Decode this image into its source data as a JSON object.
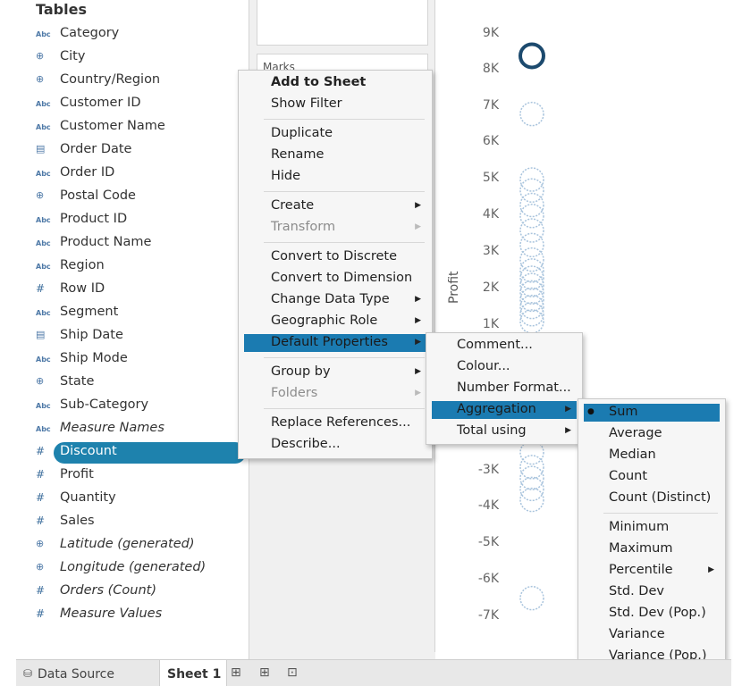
{
  "data_pane": {
    "title": "Tables",
    "fields": [
      {
        "type": "abc",
        "name": "Category",
        "italic": false
      },
      {
        "type": "globe",
        "name": "City",
        "italic": false
      },
      {
        "type": "globe",
        "name": "Country/Region",
        "italic": false
      },
      {
        "type": "abc",
        "name": "Customer ID",
        "italic": false
      },
      {
        "type": "abc",
        "name": "Customer Name",
        "italic": false
      },
      {
        "type": "cal",
        "name": "Order Date",
        "italic": false
      },
      {
        "type": "abc",
        "name": "Order ID",
        "italic": false
      },
      {
        "type": "globe",
        "name": "Postal Code",
        "italic": false
      },
      {
        "type": "abc",
        "name": "Product ID",
        "italic": false
      },
      {
        "type": "abc",
        "name": "Product Name",
        "italic": false
      },
      {
        "type": "abc",
        "name": "Region",
        "italic": false
      },
      {
        "type": "hash",
        "name": "Row ID",
        "italic": false
      },
      {
        "type": "abc",
        "name": "Segment",
        "italic": false
      },
      {
        "type": "cal",
        "name": "Ship Date",
        "italic": false
      },
      {
        "type": "abc",
        "name": "Ship Mode",
        "italic": false
      },
      {
        "type": "globe",
        "name": "State",
        "italic": false
      },
      {
        "type": "abc",
        "name": "Sub-Category",
        "italic": false
      },
      {
        "type": "abc",
        "name": "Measure Names",
        "italic": true
      },
      {
        "type": "hash",
        "name": "Discount",
        "italic": false,
        "selected": true
      },
      {
        "type": "hash",
        "name": "Profit",
        "italic": false
      },
      {
        "type": "hash",
        "name": "Quantity",
        "italic": false
      },
      {
        "type": "hash",
        "name": "Sales",
        "italic": false
      },
      {
        "type": "globe",
        "name": "Latitude (generated)",
        "italic": true
      },
      {
        "type": "globe",
        "name": "Longitude (generated)",
        "italic": true
      },
      {
        "type": "hash",
        "name": "Orders (Count)",
        "italic": true
      },
      {
        "type": "hash",
        "name": "Measure Values",
        "italic": true
      }
    ],
    "icon_glyphs": {
      "abc": "Abc",
      "globe": "⊕",
      "cal": "▤",
      "hash": "#"
    }
  },
  "shelves": {
    "marks_label": "Marks"
  },
  "view": {
    "y_axis_title": "Profit",
    "y_ticks": [
      "9K",
      "8K",
      "7K",
      "6K",
      "5K",
      "4K",
      "3K",
      "2K",
      "1K",
      "-3K",
      "-4K",
      "-5K",
      "-6K",
      "-7K"
    ]
  },
  "chart_data": {
    "type": "scatter",
    "ylabel": "Profit",
    "ylim": [
      -7500,
      9300
    ],
    "x": [
      0
    ],
    "points_profit": [
      8400,
      6800,
      5000,
      4700,
      4300,
      4000,
      3600,
      3200,
      2800,
      2500,
      2300,
      2100,
      1900,
      1700,
      1500,
      1300,
      1100,
      -2500,
      -2900,
      -3200,
      -3500,
      -3800,
      -6500
    ],
    "highlighted_point": 8400
  },
  "context_menu": {
    "items": [
      {
        "label": "Add to Sheet",
        "bold": true
      },
      {
        "label": "Show Filter"
      },
      {
        "sep": true
      },
      {
        "label": "Duplicate"
      },
      {
        "label": "Rename"
      },
      {
        "label": "Hide"
      },
      {
        "sep": true
      },
      {
        "label": "Create",
        "submenu": true
      },
      {
        "label": "Transform",
        "submenu": true,
        "disabled": true
      },
      {
        "sep": true
      },
      {
        "label": "Convert to Discrete"
      },
      {
        "label": "Convert to Dimension"
      },
      {
        "label": "Change Data Type",
        "submenu": true
      },
      {
        "label": "Geographic Role",
        "submenu": true
      },
      {
        "label": "Default Properties",
        "submenu": true,
        "highlighted": true
      },
      {
        "sep": true
      },
      {
        "label": "Group by",
        "submenu": true
      },
      {
        "label": "Folders",
        "submenu": true,
        "disabled": true
      },
      {
        "sep": true
      },
      {
        "label": "Replace References..."
      },
      {
        "label": "Describe..."
      }
    ]
  },
  "default_properties_menu": {
    "items": [
      {
        "label": "Comment..."
      },
      {
        "label": "Colour..."
      },
      {
        "label": "Number Format..."
      },
      {
        "label": "Aggregation",
        "submenu": true,
        "highlighted": true
      },
      {
        "label": "Total using",
        "submenu": true
      }
    ]
  },
  "aggregation_menu": {
    "items": [
      {
        "label": "Sum",
        "checked": true,
        "highlighted": true
      },
      {
        "label": "Average"
      },
      {
        "label": "Median"
      },
      {
        "label": "Count"
      },
      {
        "label": "Count (Distinct)"
      },
      {
        "sep": true
      },
      {
        "label": "Minimum"
      },
      {
        "label": "Maximum"
      },
      {
        "label": "Percentile",
        "submenu": true
      },
      {
        "label": "Std. Dev"
      },
      {
        "label": "Std. Dev (Pop.)"
      },
      {
        "label": "Variance"
      },
      {
        "label": "Variance (Pop.)"
      }
    ]
  },
  "tabs": {
    "data_source": "Data Source",
    "sheet": "Sheet 1",
    "new_worksheet_icon": "new-worksheet-icon",
    "new_dashboard_icon": "new-dashboard-icon",
    "new_story_icon": "new-story-icon"
  },
  "colors": {
    "selection": "#1e82ad",
    "menu_highlight": "#1b7bb1",
    "mark": "#4e79a7"
  }
}
